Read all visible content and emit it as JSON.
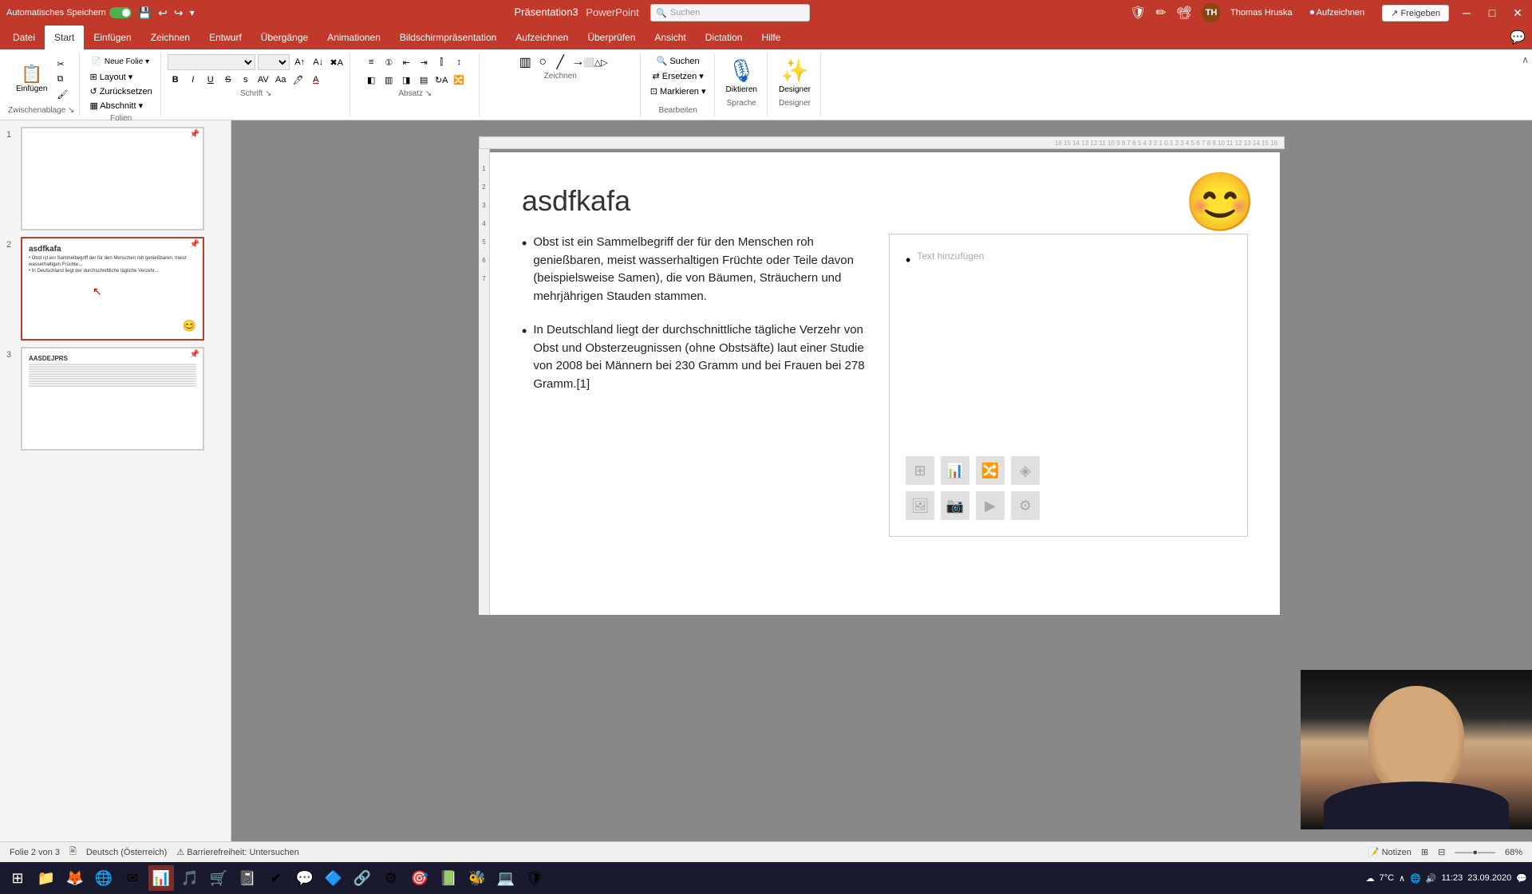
{
  "titlebar": {
    "autosave_label": "Automatisches Speichern",
    "file_name": "Präsentation3",
    "app_name": "PowerPoint",
    "user_name": "Thomas Hruska",
    "user_initials": "TH",
    "search_placeholder": "Suchen"
  },
  "ribbon": {
    "tabs": [
      "Datei",
      "Start",
      "Einfügen",
      "Zeichnen",
      "Entwurf",
      "Übergänge",
      "Animationen",
      "Bildschirmpräsentation",
      "Aufzeichnen",
      "Überprüfen",
      "Ansicht",
      "Dictation",
      "Hilfe"
    ],
    "active_tab": "Start",
    "groups": {
      "zwischenablage": {
        "label": "Zwischenablage",
        "buttons": [
          "Einfügen",
          "Neue Folie"
        ]
      },
      "folien": {
        "label": "Folien",
        "buttons": [
          "Layout",
          "Zurücksetzen",
          "Abschnitt"
        ]
      },
      "schrift": {
        "label": "Schrift",
        "buttons": []
      },
      "absatz": {
        "label": "Absatz",
        "buttons": []
      },
      "zeichnen": {
        "label": "Zeichnen",
        "buttons": []
      },
      "bearbeiten": {
        "label": "Bearbeiten",
        "buttons": [
          "Suchen",
          "Ersetzen",
          "Markieren"
        ]
      },
      "sprache": {
        "label": "Sprache",
        "buttons": [
          "Diktieren"
        ]
      },
      "designer": {
        "label": "Designer",
        "buttons": [
          "Designer"
        ]
      }
    }
  },
  "slides": [
    {
      "num": 1,
      "active": false,
      "content_type": "blank"
    },
    {
      "num": 2,
      "active": true,
      "title": "asdfkafa",
      "bullet1": "Obst ist ein Sammelbegriff der für den Menschen roh genießbaren, meist wasserhaltigen Früchte oder Teile davon (beispielsweise Samen), die von Bäumen, Sträuchern und mehrjährigen Stauden stammen.",
      "bullet2": "In Deutschland liegt der durchschnittliche tägliche Verzehr von Obst und Obsterzeugnissen (ohne Obstsäfte) laut einer Studie von 2008 bei Männern bei 230 Gramm und bei Frauen bei 278 Gramm.[1]",
      "placeholder_text": "Text hinzufügen"
    },
    {
      "num": 3,
      "active": false,
      "title": "AASDEJPRS"
    }
  ],
  "statusbar": {
    "slide_info": "Folie 2 von 3",
    "language": "Deutsch (Österreich)",
    "accessibility": "Barrierefreiheit: Untersuchen",
    "notes": "Notizen"
  },
  "taskbar": {
    "time": "7°C",
    "icons": [
      "⊞",
      "📁",
      "🦊",
      "🌐",
      "✉",
      "📊",
      "🎵",
      "🛒",
      "📓",
      "✔",
      "🔷",
      "🔗",
      "⚙",
      "🎯",
      "📗",
      "🐝",
      "💻",
      "🛡"
    ]
  }
}
